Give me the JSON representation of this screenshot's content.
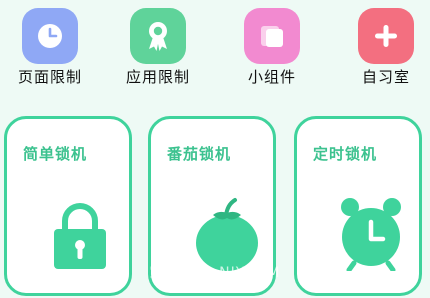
{
  "shortcuts": [
    {
      "label": "页面限制",
      "icon": "clock-icon",
      "color": "#8fa8f5"
    },
    {
      "label": "应用限制",
      "icon": "award-ribbon-icon",
      "color": "#5fd39a"
    },
    {
      "label": "小组件",
      "icon": "widget-cards-icon",
      "color": "#f28ad0"
    },
    {
      "label": "自习室",
      "icon": "plus-icon",
      "color": "#f36f80"
    }
  ],
  "cards": [
    {
      "title": "简单锁机",
      "icon": "padlock-icon"
    },
    {
      "title": "番茄锁机",
      "icon": "tomato-icon"
    },
    {
      "title": "定时锁机",
      "icon": "alarm-clock-icon"
    }
  ],
  "accent": "#3fd39c",
  "watermark": "宝 ♦ ● - NIYCOM"
}
